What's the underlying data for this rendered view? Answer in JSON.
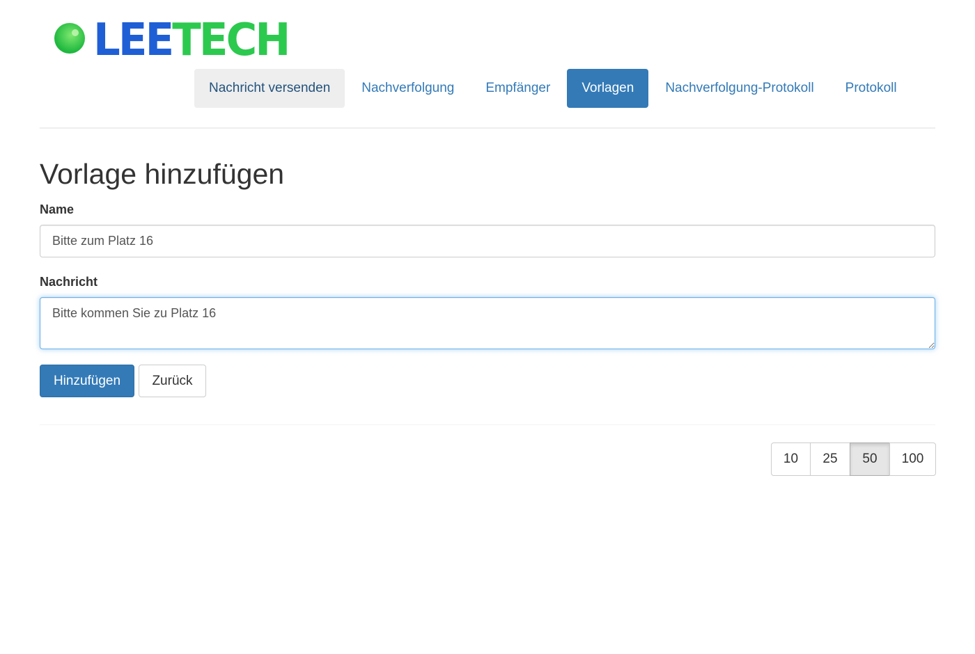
{
  "logo": {
    "text_part1": "LEE",
    "text_part2": "TECH",
    "colors": {
      "lee": "#1f5fd6",
      "tech": "#2cc94f"
    }
  },
  "nav": {
    "items": [
      {
        "label": "Nachricht versenden",
        "state": "hover"
      },
      {
        "label": "Nachverfolgung",
        "state": "normal"
      },
      {
        "label": "Empfänger",
        "state": "normal"
      },
      {
        "label": "Vorlagen",
        "state": "active"
      },
      {
        "label": "Nachverfolgung-Protokoll",
        "state": "normal"
      },
      {
        "label": "Protokoll",
        "state": "normal"
      }
    ]
  },
  "form": {
    "title": "Vorlage hinzufügen",
    "name_label": "Name",
    "name_value": "Bitte zum Platz 16",
    "message_label": "Nachricht",
    "message_value": "Bitte kommen Sie zu Platz 16",
    "submit_label": "Hinzufügen",
    "back_label": "Zurück"
  },
  "page_size": {
    "options": [
      "10",
      "25",
      "50",
      "100"
    ],
    "selected": "50"
  },
  "colors": {
    "primary": "#337ab7",
    "link": "#337ab7",
    "focus_border": "#66afe9"
  }
}
